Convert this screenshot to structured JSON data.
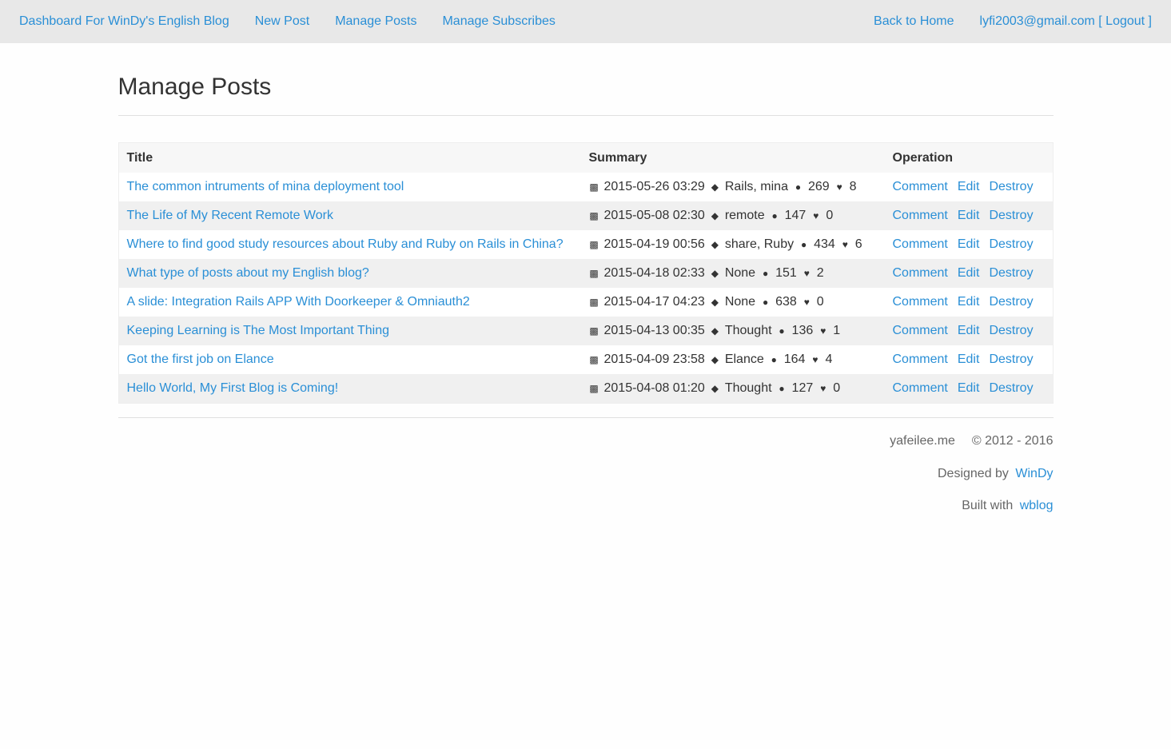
{
  "nav": {
    "brand": "Dashboard For WinDy's English Blog",
    "links": [
      "New Post",
      "Manage Posts",
      "Manage Subscribes"
    ],
    "back_home": "Back to Home",
    "user": "lyfi2003@gmail.com [ Logout ]"
  },
  "page": {
    "title": "Manage Posts"
  },
  "table": {
    "headers": [
      "Title",
      "Summary",
      "Operation"
    ],
    "icons": {
      "date": "calendar-icon",
      "tags": "tag-icon",
      "views": "users-icon",
      "likes": "heart-icon"
    },
    "ops": [
      "Comment",
      "Edit",
      "Destroy"
    ],
    "rows": [
      {
        "title": "The common intruments of mina deployment tool",
        "date": "2015-05-26 03:29",
        "tags": "Rails, mina",
        "views": "269",
        "likes": "8"
      },
      {
        "title": "The Life of My Recent Remote Work",
        "date": "2015-05-08 02:30",
        "tags": "remote",
        "views": "147",
        "likes": "0"
      },
      {
        "title": "Where to find good study resources about Ruby and Ruby on Rails in China?",
        "date": "2015-04-19 00:56",
        "tags": "share, Ruby",
        "views": "434",
        "likes": "6"
      },
      {
        "title": "What type of posts about my English blog?",
        "date": "2015-04-18 02:33",
        "tags": "None",
        "views": "151",
        "likes": "2"
      },
      {
        "title": "A slide: Integration Rails APP With Doorkeeper & Omniauth2",
        "date": "2015-04-17 04:23",
        "tags": "None",
        "views": "638",
        "likes": "0"
      },
      {
        "title": "Keeping Learning is The Most Important Thing",
        "date": "2015-04-13 00:35",
        "tags": "Thought",
        "views": "136",
        "likes": "1"
      },
      {
        "title": "Got the first job on Elance",
        "date": "2015-04-09 23:58",
        "tags": "Elance",
        "views": "164",
        "likes": "4"
      },
      {
        "title": "Hello World, My First Blog is Coming!",
        "date": "2015-04-08 01:20",
        "tags": "Thought",
        "views": "127",
        "likes": "0"
      }
    ]
  },
  "footer": {
    "site": "yafeilee.me",
    "copyright": "© 2012 - 2016",
    "designed_by": "Designed by",
    "designer": "WinDy",
    "built_with": "Built with",
    "engine": "wblog"
  },
  "colors": {
    "link": "#2a8fd6",
    "navbar_bg": "#e8e8e8",
    "stripe": "#f0f0f0"
  }
}
